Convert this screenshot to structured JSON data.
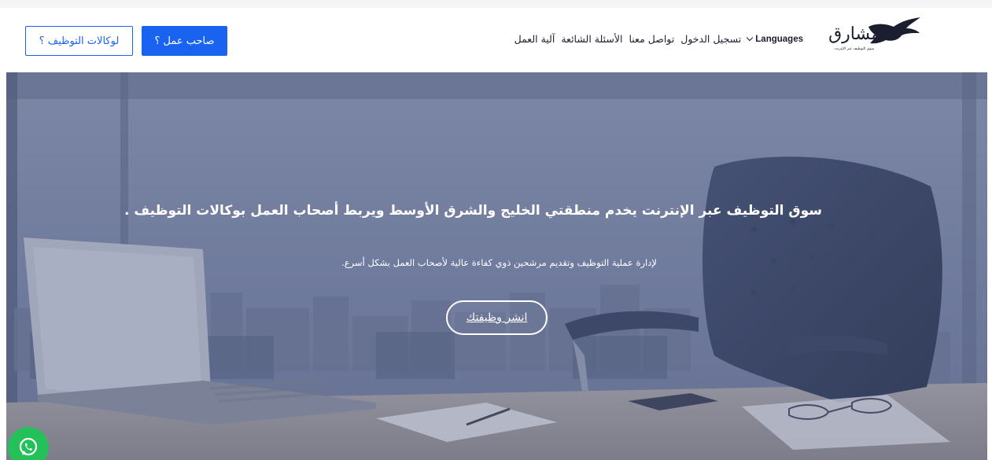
{
  "brand": {
    "logo_text": "مشارق",
    "logo_tagline": "سوق التوظيف عبر الإنترنت",
    "logo_color": "#1b1e2e"
  },
  "nav": {
    "items": [
      {
        "label": "آلية العمل"
      },
      {
        "label": "الأسئلة الشائعة"
      },
      {
        "label": "تواصل معنا"
      },
      {
        "label": "تسجيل الدخول"
      }
    ],
    "languages_label": "Languages"
  },
  "header_buttons": {
    "employer_label": "صاحب عمل ؟",
    "agency_label": "لوكالات التوظيف ؟"
  },
  "hero": {
    "title": "سوق التوظيف عبر الإنترنت يخدم منطقتي الخليج والشرق الأوسط ويربط أصحاب العمل بوكالات التوظيف .",
    "subtitle": "لإدارة عملية التوظيف وتقديم مرشحين ذوي كفاءة عالية لأصحاب العمل بشكل أسرع.",
    "cta_label": "انشر وظيفتك"
  },
  "colors": {
    "accent": "#1a63f0",
    "whatsapp": "#24c15b",
    "hero_overlay": "#5d6a8f"
  },
  "icons": {
    "chevron": "chevron-down-icon",
    "whatsapp": "whatsapp-icon",
    "logo": "eagle-logo-icon"
  }
}
